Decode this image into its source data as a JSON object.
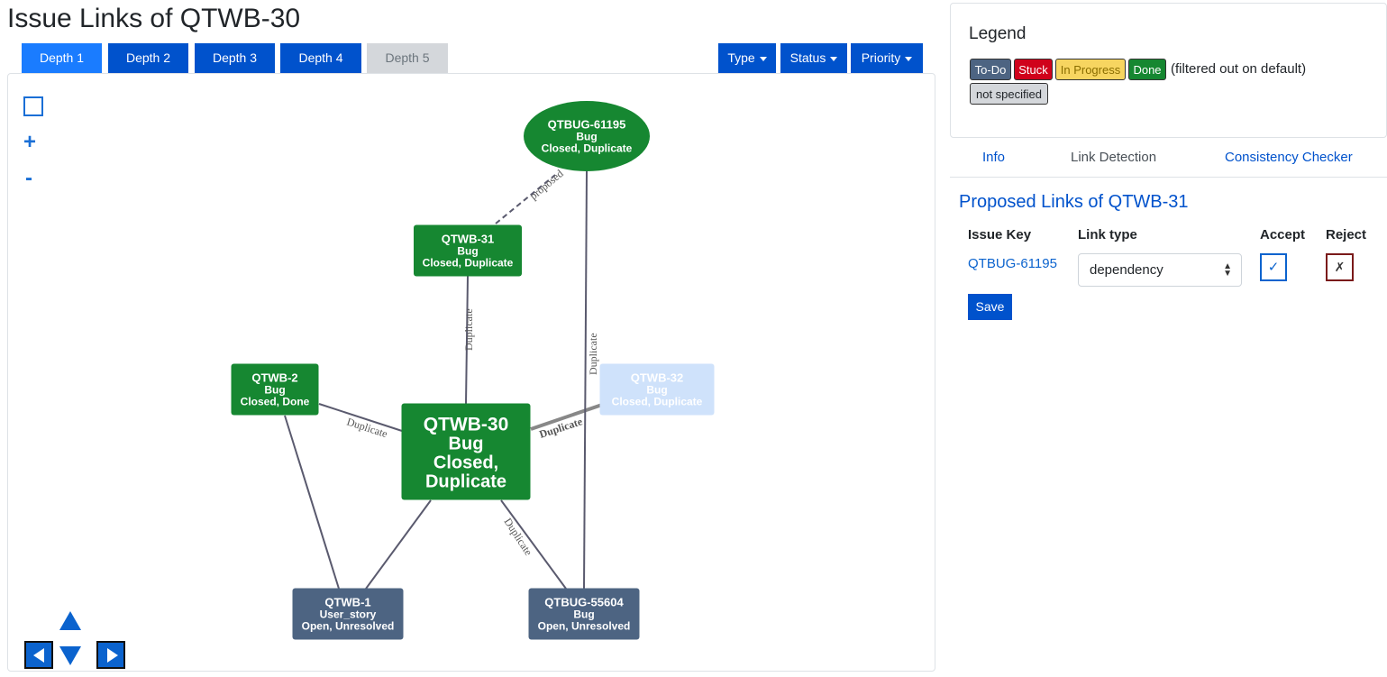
{
  "page_title": "Issue Links of QTWB-30",
  "depth_tabs": [
    {
      "label": "Depth 1",
      "state": "active"
    },
    {
      "label": "Depth 2",
      "state": "normal"
    },
    {
      "label": "Depth 3",
      "state": "normal"
    },
    {
      "label": "Depth 4",
      "state": "normal"
    },
    {
      "label": "Depth 5",
      "state": "disabled"
    }
  ],
  "filters": {
    "type": "Type",
    "status": "Status",
    "priority": "Priority"
  },
  "graph_controls": {
    "zoom_in": "+",
    "zoom_out": "-"
  },
  "graph": {
    "colors": {
      "done": "#168731",
      "todo": "#4d6482",
      "filtered": "#cfe2fb",
      "edge": "#5a5a6e",
      "selected_edge": "#888888"
    },
    "nodes": [
      {
        "id": "QTBUG-61195",
        "lines": [
          "QTBUG-61195",
          "Bug",
          "Closed, Duplicate"
        ],
        "status": "done"
      },
      {
        "id": "QTWB-31",
        "lines": [
          "QTWB-31",
          "Bug",
          "Closed, Duplicate"
        ],
        "status": "done"
      },
      {
        "id": "QTWB-2",
        "lines": [
          "QTWB-2",
          "Bug",
          "Closed, Done"
        ],
        "status": "done"
      },
      {
        "id": "QTWB-32",
        "lines": [
          "QTWB-32",
          "Bug",
          "Closed, Duplicate"
        ],
        "status": "filtered"
      },
      {
        "id": "QTWB-30",
        "lines": [
          "QTWB-30",
          "Bug",
          "Closed,",
          "Duplicate"
        ],
        "status": "done"
      },
      {
        "id": "QTWB-1",
        "lines": [
          "QTWB-1",
          "User_story",
          "Open, Unresolved"
        ],
        "status": "todo"
      },
      {
        "id": "QTBUG-55604",
        "lines": [
          "QTBUG-55604",
          "Bug",
          "Open, Unresolved"
        ],
        "status": "todo"
      }
    ],
    "edges": [
      {
        "from": "QTWB-31",
        "to": "QTBUG-61195",
        "label": "proposed",
        "style": "dashed"
      },
      {
        "from": "QTWB-30",
        "to": "QTWB-31",
        "label": "Duplicate",
        "style": "solid"
      },
      {
        "from": "QTWB-30",
        "to": "QTWB-2",
        "label": "Duplicate",
        "style": "solid"
      },
      {
        "from": "QTWB-30",
        "to": "QTWB-32",
        "label": "Duplicate",
        "style": "bold"
      },
      {
        "from": "QTBUG-61195",
        "to": "QTBUG-55604",
        "label": "Duplicate",
        "style": "solid"
      },
      {
        "from": "QTWB-30",
        "to": "QTBUG-55604",
        "label": "Duplicate",
        "style": "solid"
      },
      {
        "from": "QTWB-30",
        "to": "QTWB-1",
        "label": "",
        "style": "solid"
      },
      {
        "from": "QTWB-2",
        "to": "QTWB-1",
        "label": "",
        "style": "solid"
      }
    ]
  },
  "legend": {
    "title": "Legend",
    "badges": [
      {
        "label": "To-Do",
        "bg": "#4d6482",
        "fg": "#ffffff"
      },
      {
        "label": "Stuck",
        "bg": "#d0021b",
        "fg": "#ffffff"
      },
      {
        "label": "In Progress",
        "bg": "#f7d560",
        "fg": "#8a6d00"
      },
      {
        "label": "Done",
        "bg": "#168731",
        "fg": "#ffffff"
      },
      {
        "label": "not specified",
        "bg": "#d4d7db",
        "fg": "#212529"
      }
    ],
    "note": "(filtered out on default)"
  },
  "info_tabs": [
    {
      "label": "Info",
      "state": "normal"
    },
    {
      "label": "Link Detection",
      "state": "active"
    },
    {
      "label": "Consistency Checker",
      "state": "normal"
    }
  ],
  "proposed": {
    "title": "Proposed Links of QTWB-31",
    "headers": {
      "issue_key": "Issue Key",
      "link_type": "Link type",
      "accept": "Accept",
      "reject": "Reject"
    },
    "rows": [
      {
        "issue_key": "QTBUG-61195",
        "link_type": "dependency",
        "accept": "✓",
        "reject": "✗"
      }
    ],
    "save_label": "Save"
  }
}
